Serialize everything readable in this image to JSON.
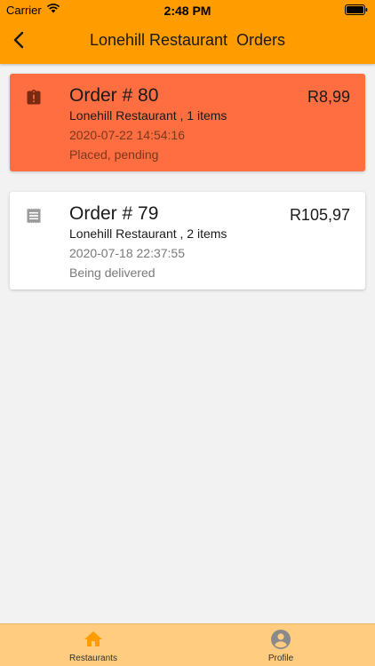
{
  "status_bar": {
    "carrier": "Carrier",
    "time": "2:48 PM"
  },
  "header": {
    "title": "Lonehill Restaurant  Orders",
    "back_icon": "chevron-left-icon"
  },
  "orders": [
    {
      "title": "Order # 80",
      "price": "R8,99",
      "subtitle": "Lonehill Restaurant , 1 items",
      "date": "2020-07-22 14:54:16",
      "status": "Placed, pending",
      "icon": "clipboard-alert-icon",
      "background": "#ff6e40"
    },
    {
      "title": "Order # 79",
      "price": "R105,97",
      "subtitle": "Lonehill Restaurant , 2 items",
      "date": "2020-07-18 22:37:55",
      "status": "Being delivered",
      "icon": "receipt-icon",
      "background": "#ffffff"
    }
  ],
  "tabbar": {
    "items": [
      {
        "label": "Restaurants",
        "icon": "home-icon",
        "active": true
      },
      {
        "label": "Profile",
        "icon": "account-circle-icon",
        "active": false
      }
    ]
  },
  "colors": {
    "header": "#ff9c00",
    "tabbar": "#ffcc80",
    "active_tab_icon": "#ff9c00",
    "inactive_tab_icon": "#8a8a8a"
  }
}
